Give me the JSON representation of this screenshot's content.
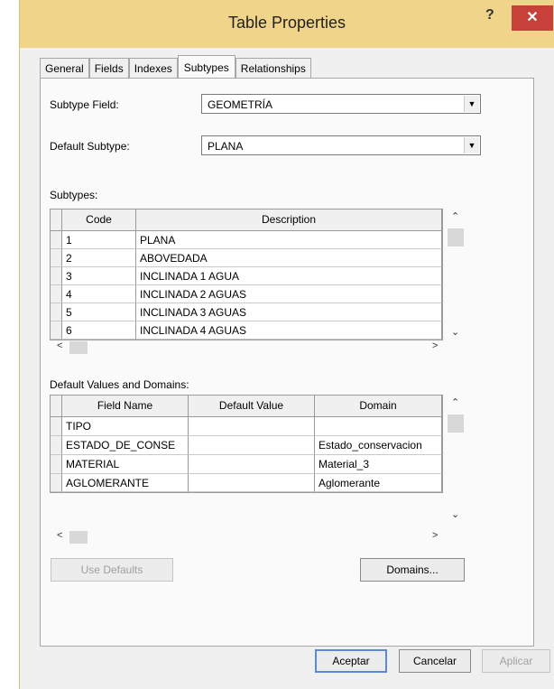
{
  "window": {
    "title": "Table Properties",
    "help_label": "?",
    "close_label": "✕"
  },
  "tabs": [
    {
      "label": "General",
      "active": false
    },
    {
      "label": "Fields",
      "active": false
    },
    {
      "label": "Indexes",
      "active": false
    },
    {
      "label": "Subtypes",
      "active": true
    },
    {
      "label": "Relationships",
      "active": false
    }
  ],
  "subtype_field": {
    "label": "Subtype Field:",
    "value": "GEOMETRÍA"
  },
  "default_subtype": {
    "label": "Default Subtype:",
    "value": "PLANA"
  },
  "subtypes": {
    "label": "Subtypes:",
    "headers": [
      "Code",
      "Description"
    ],
    "rows": [
      {
        "code": "1",
        "description": "PLANA"
      },
      {
        "code": "2",
        "description": "ABOVEDADA"
      },
      {
        "code": "3",
        "description": "INCLINADA 1 AGUA"
      },
      {
        "code": "4",
        "description": "INCLINADA 2 AGUAS"
      },
      {
        "code": "5",
        "description": "INCLINADA 3 AGUAS"
      },
      {
        "code": "6",
        "description": "INCLINADA 4 AGUAS"
      }
    ]
  },
  "defaults": {
    "label": "Default Values and Domains:",
    "headers": [
      "Field Name",
      "Default Value",
      "Domain"
    ],
    "rows": [
      {
        "field": "TIPO",
        "default": "",
        "domain": ""
      },
      {
        "field": "ESTADO_DE_CONSE",
        "default": "",
        "domain": "Estado_conservacion"
      },
      {
        "field": "MATERIAL",
        "default": "",
        "domain": "Material_3"
      },
      {
        "field": "AGLOMERANTE",
        "default": "",
        "domain": "Aglomerante"
      }
    ]
  },
  "buttons": {
    "use_defaults": "Use Defaults",
    "domains": "Domains...",
    "ok": "Aceptar",
    "cancel": "Cancelar",
    "apply": "Aplicar"
  },
  "colors": {
    "titlebar": "#f0d489",
    "close": "#c8403a",
    "accent": "#5a8ad8"
  }
}
